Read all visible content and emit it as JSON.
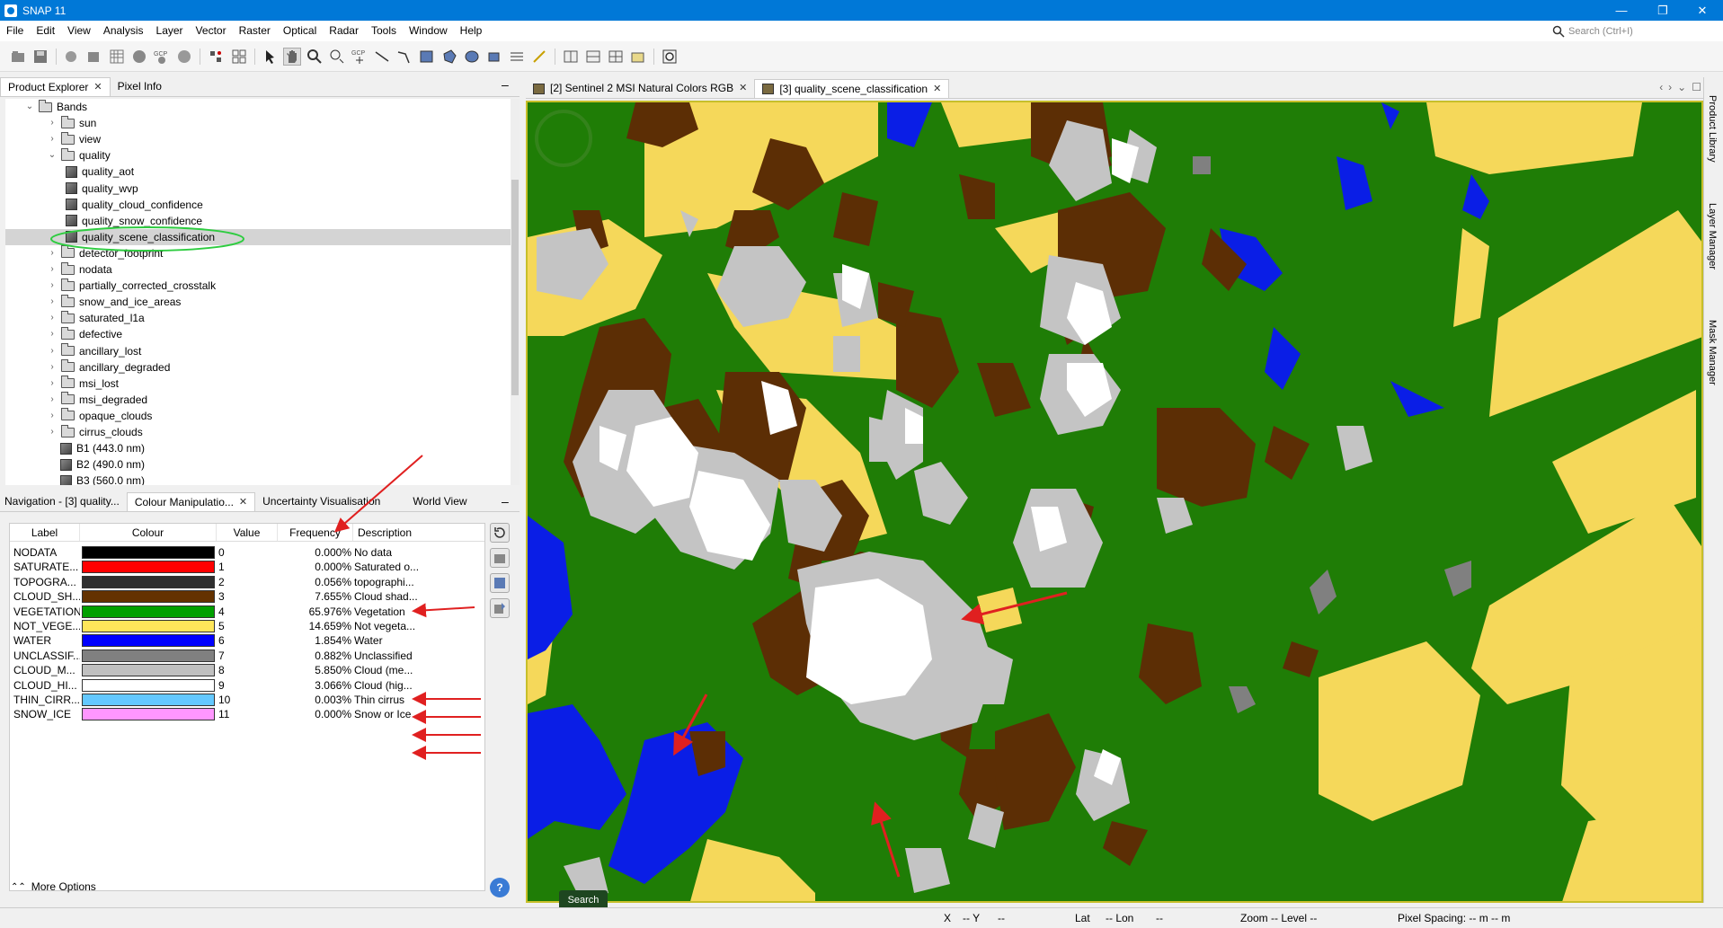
{
  "window": {
    "title": "SNAP 11",
    "minimize": "—",
    "maximize": "❐",
    "close": "✕"
  },
  "menu": [
    "File",
    "Edit",
    "View",
    "Analysis",
    "Layer",
    "Vector",
    "Raster",
    "Optical",
    "Radar",
    "Tools",
    "Window",
    "Help"
  ],
  "search": {
    "placeholder": "Search (Ctrl+I)"
  },
  "toolbar": {
    "icons": [
      "open-product",
      "save-product",
      "export",
      "pixel-geo",
      "graph",
      "gcp",
      "mask",
      "pin",
      "range",
      "select",
      "pan",
      "zoom",
      "zoom-tool",
      "gcp-tool",
      "line",
      "polygon",
      "shape",
      "ellipse",
      "magic-wand",
      "range-finder",
      "draw",
      "tile-h",
      "tile-v",
      "tile-grid",
      "tile-cascade",
      "sync"
    ]
  },
  "left_tabs": [
    {
      "label": "Product Explorer",
      "close": "✕"
    },
    {
      "label": "Pixel Info"
    }
  ],
  "tree": {
    "bands": "Bands",
    "items": [
      {
        "label": "sun",
        "type": "folder"
      },
      {
        "label": "view",
        "type": "folder"
      },
      {
        "label": "quality",
        "type": "folder-open"
      },
      {
        "label": "quality_aot",
        "type": "band"
      },
      {
        "label": "quality_wvp",
        "type": "band"
      },
      {
        "label": "quality_cloud_confidence",
        "type": "band"
      },
      {
        "label": "quality_snow_confidence",
        "type": "band"
      },
      {
        "label": "quality_scene_classification",
        "type": "band",
        "selected": true
      },
      {
        "label": "detector_footprint",
        "type": "folder"
      },
      {
        "label": "nodata",
        "type": "folder"
      },
      {
        "label": "partially_corrected_crosstalk",
        "type": "folder"
      },
      {
        "label": "snow_and_ice_areas",
        "type": "folder"
      },
      {
        "label": "saturated_l1a",
        "type": "folder"
      },
      {
        "label": "defective",
        "type": "folder"
      },
      {
        "label": "ancillary_lost",
        "type": "folder"
      },
      {
        "label": "ancillary_degraded",
        "type": "folder"
      },
      {
        "label": "msi_lost",
        "type": "folder"
      },
      {
        "label": "msi_degraded",
        "type": "folder"
      },
      {
        "label": "opaque_clouds",
        "type": "folder"
      },
      {
        "label": "cirrus_clouds",
        "type": "folder"
      },
      {
        "label": "B1 (443.0 nm)",
        "type": "band"
      },
      {
        "label": "B2 (490.0 nm)",
        "type": "band"
      },
      {
        "label": "B3 (560.0 nm)",
        "type": "band"
      }
    ]
  },
  "bottom_tabs": [
    {
      "label": "Navigation - [3] quality..."
    },
    {
      "label": "Colour Manipulatio...",
      "close": "✕"
    },
    {
      "label": "Uncertainty Visualisation"
    },
    {
      "label": "World View"
    }
  ],
  "colour_table": {
    "headers": [
      "Label",
      "Colour",
      "Value",
      "Frequency",
      "Description"
    ],
    "rows": [
      {
        "label": "NODATA",
        "color": "#000000",
        "value": "0",
        "freq": "0.000%",
        "desc": "No data"
      },
      {
        "label": "SATURATE...",
        "color": "#ff0000",
        "value": "1",
        "freq": "0.000%",
        "desc": "Saturated o..."
      },
      {
        "label": "TOPOGRA...",
        "color": "#2f2f2f",
        "value": "2",
        "freq": "0.056%",
        "desc": "topographi..."
      },
      {
        "label": "CLOUD_SH...",
        "color": "#643200",
        "value": "3",
        "freq": "7.655%",
        "desc": "Cloud shad..."
      },
      {
        "label": "VEGETATION",
        "color": "#00a000",
        "value": "4",
        "freq": "65.976%",
        "desc": "Vegetation"
      },
      {
        "label": "NOT_VEGE...",
        "color": "#ffe65a",
        "value": "5",
        "freq": "14.659%",
        "desc": "Not vegeta..."
      },
      {
        "label": "WATER",
        "color": "#0000ff",
        "value": "6",
        "freq": "1.854%",
        "desc": "Water"
      },
      {
        "label": "UNCLASSIF...",
        "color": "#808080",
        "value": "7",
        "freq": "0.882%",
        "desc": "Unclassified"
      },
      {
        "label": "CLOUD_M...",
        "color": "#c0c0c0",
        "value": "8",
        "freq": "5.850%",
        "desc": "Cloud (me..."
      },
      {
        "label": "CLOUD_HI...",
        "color": "#ffffff",
        "value": "9",
        "freq": "3.066%",
        "desc": "Cloud (hig..."
      },
      {
        "label": "THIN_CIRR...",
        "color": "#64c8ff",
        "value": "10",
        "freq": "0.003%",
        "desc": "Thin cirrus"
      },
      {
        "label": "SNOW_ICE",
        "color": "#ff96ff",
        "value": "11",
        "freq": "0.000%",
        "desc": "Snow or Ice"
      }
    ]
  },
  "more_options": "More Options",
  "view_tabs": [
    {
      "label": "[2] Sentinel 2 MSI Natural Colors RGB",
      "close": "✕"
    },
    {
      "label": "[3] quality_scene_classification",
      "close": "✕"
    }
  ],
  "right_strip": [
    "Product Library",
    "Layer Manager",
    "Mask Manager"
  ],
  "status": {
    "x": "X",
    "x_val": "-- Y",
    "y_val": "--",
    "lat": "Lat",
    "lat_val": "-- Lon",
    "lon_val": "--",
    "zoom": "Zoom -- Level --",
    "spacing": "Pixel Spacing: -- m -- m"
  },
  "tooltip": "Search",
  "colors": {
    "vegetation": "#1f7d06",
    "not_veg": "#f5d85a",
    "shadow": "#5c2e05",
    "water": "#0a1ee6",
    "cloud_med": "#c0c0c0",
    "cloud_high": "#ffffff",
    "unclass": "#808080",
    "accent": "#0078d7",
    "annotation": "#e02020"
  }
}
